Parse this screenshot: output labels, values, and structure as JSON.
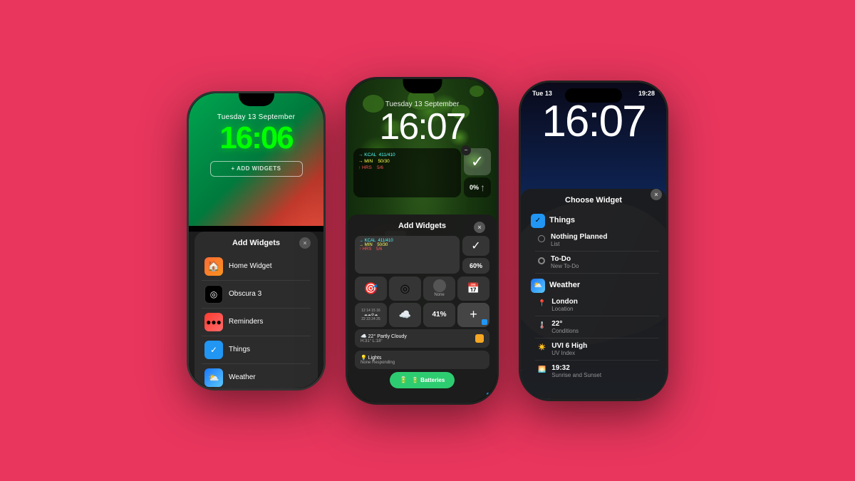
{
  "background": "#e8365d",
  "phone1": {
    "date": "Tuesday 13 September",
    "time": "16:06",
    "add_btn_label": "+ ADD WIDGETS",
    "panel_title": "Add Widgets",
    "panel_close": "×",
    "items": [
      {
        "label": "Home Widget",
        "icon": "🏠",
        "class": "icon-home"
      },
      {
        "label": "Obscura 3",
        "icon": "⊙",
        "class": "icon-obscura"
      },
      {
        "label": "Reminders",
        "icon": "🔔",
        "class": "icon-reminders"
      },
      {
        "label": "Things",
        "icon": "✓",
        "class": "icon-things"
      },
      {
        "label": "Weather",
        "icon": "⛅",
        "class": "icon-weather"
      }
    ]
  },
  "phone2": {
    "date": "Tuesday 13 September",
    "time": "16:07",
    "panel_title": "Add Widgets",
    "panel_close": "×",
    "fitness": {
      "kcal": "→ KCAL  411/410",
      "min": "→ MIN    50/30",
      "hrs": "↑ HRS    5/6"
    },
    "weather_line": "☁️ 22°  Partly Cloudy  H:31° L:18°",
    "lights_line": "💡 Lights  None Responding",
    "batteries_label": "🔋 Batteries",
    "percent_41": "41%",
    "percent_60": "60%",
    "percent_0": "0%"
  },
  "phone3": {
    "statusbar_left": "Tue 13",
    "statusbar_right": "19:28",
    "time": "16:07",
    "panel_title": "Choose Widget",
    "panel_close": "×",
    "sections": {
      "things_header": "Things",
      "things_items": [
        {
          "label": "Nothing Planned",
          "sub": "List"
        },
        {
          "label": "To-Do",
          "sub": "New To-Do"
        }
      ],
      "weather_header": "Weather",
      "weather_items": [
        {
          "label": "London",
          "sub": "Location"
        },
        {
          "label": "22°",
          "sub": "Conditions"
        },
        {
          "label": "UVI 6 High",
          "sub": "UV Index"
        },
        {
          "label": "19:32",
          "sub": "Sunrise and Sunset"
        }
      ]
    }
  }
}
